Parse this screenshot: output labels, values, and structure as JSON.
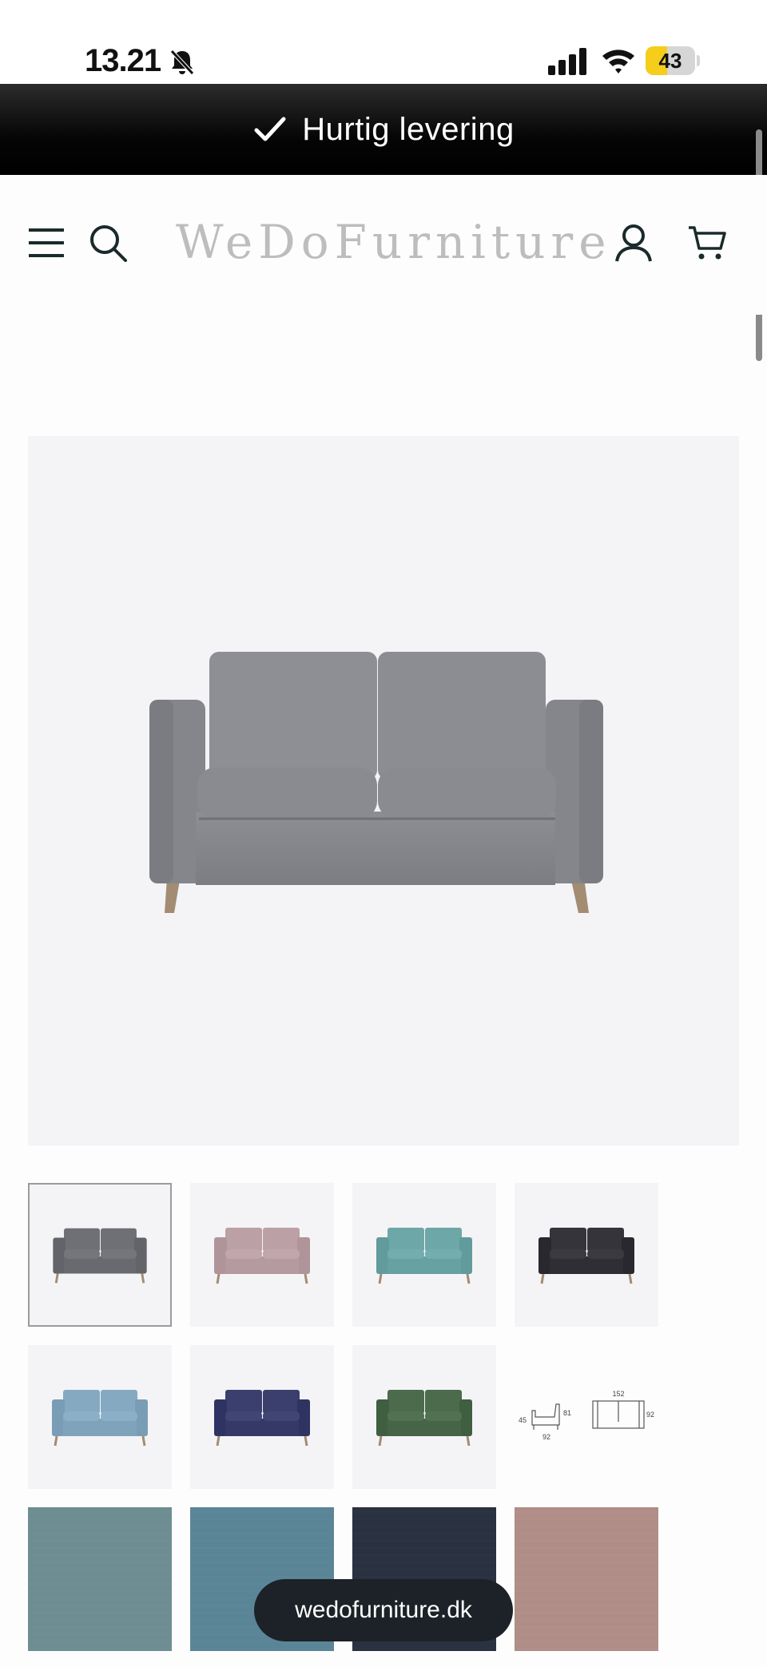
{
  "status_bar": {
    "time": "13.21",
    "battery_level": "43",
    "battery_color": "#f5cd1a"
  },
  "announcement": {
    "text": "Hurtig levering",
    "icon": "check-icon"
  },
  "header": {
    "logo": "WeDoFurniture",
    "icons": [
      "menu-icon",
      "search-icon",
      "account-icon",
      "cart-icon"
    ]
  },
  "main_image": {
    "description_color": "gray",
    "icon": "sofa-image"
  },
  "thumbnails": [
    {
      "kind": "sofa",
      "color": "#6f7075",
      "selected": true
    },
    {
      "kind": "sofa",
      "color": "#bba0a5",
      "selected": false
    },
    {
      "kind": "sofa",
      "color": "#6ea7a7",
      "selected": false
    },
    {
      "kind": "sofa",
      "color": "#34343a",
      "selected": false
    },
    {
      "kind": "sofa",
      "color": "#86a9c2",
      "selected": false
    },
    {
      "kind": "sofa",
      "color": "#3b3f6e",
      "selected": false
    },
    {
      "kind": "sofa",
      "color": "#4b6b4c",
      "selected": false
    },
    {
      "kind": "diagram",
      "dims": {
        "seat_h": "45",
        "height": "81",
        "depth": "92",
        "width": "152",
        "depth2": "92"
      }
    },
    {
      "kind": "swatch",
      "color": "#6e8d92"
    },
    {
      "kind": "swatch",
      "color": "#5a8596"
    },
    {
      "kind": "swatch",
      "color": "#2a3140"
    },
    {
      "kind": "swatch",
      "color": "#b08d86"
    }
  ],
  "browser": {
    "url": "wedofurniture.dk"
  }
}
